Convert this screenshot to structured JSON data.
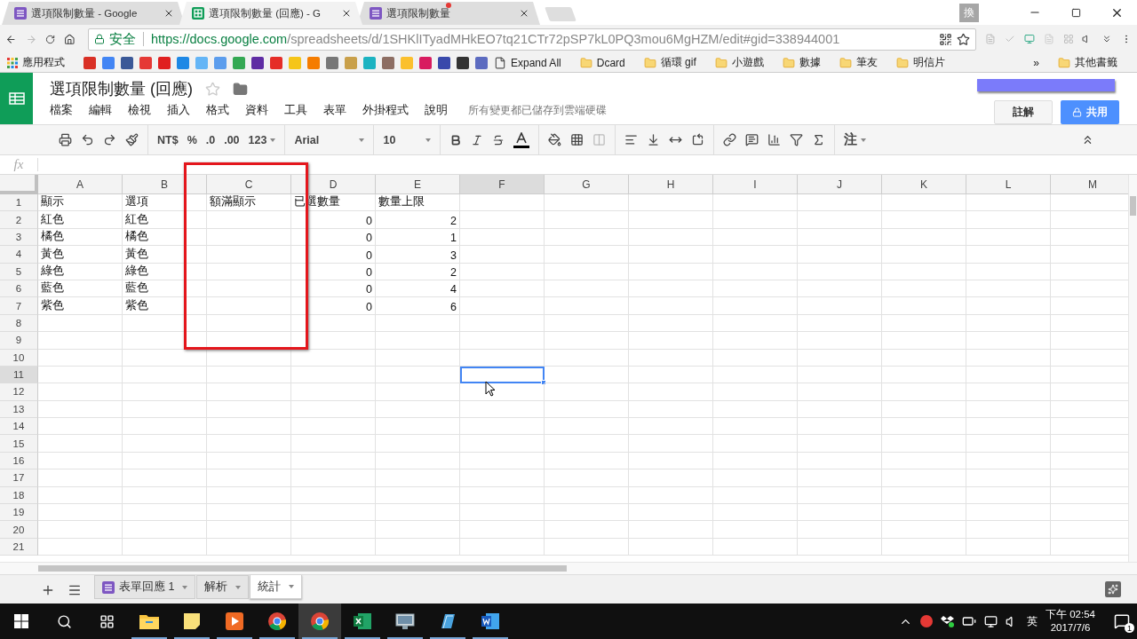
{
  "browser": {
    "tabs": [
      {
        "title": "選項限制數量 - Google",
        "kind": "form",
        "selected": false,
        "alert": false
      },
      {
        "title": "選項限制數量 (回應) - G",
        "kind": "sheet",
        "selected": true,
        "alert": false
      },
      {
        "title": "選項限制數量",
        "kind": "form",
        "selected": false,
        "alert": true
      }
    ],
    "ime_indicator": "換",
    "address": {
      "security": "安全",
      "origin": "https://docs.google.com",
      "path": "/spreadsheets/d/1SHKlITyadMHkEO7tq21CTr72pSP7kL0PQ3mou6MgHZM/edit#gid=338944001"
    },
    "bookmarks": {
      "apps_label": "應用程式",
      "items": [
        {
          "label": "Expand All",
          "kind": "page"
        },
        {
          "label": "Dcard",
          "kind": "folder"
        },
        {
          "label": "循環 gif",
          "kind": "folder"
        },
        {
          "label": "小遊戲",
          "kind": "folder"
        },
        {
          "label": "數據",
          "kind": "folder"
        },
        {
          "label": "筆友",
          "kind": "folder"
        },
        {
          "label": "明信片",
          "kind": "folder"
        }
      ],
      "overflow": "»",
      "other": "其他書籤"
    }
  },
  "document": {
    "title": "選項限制數量 (回應)",
    "starred": false,
    "menu": [
      "檔案",
      "編輯",
      "檢視",
      "插入",
      "格式",
      "資料",
      "工具",
      "表單",
      "外掛程式",
      "說明"
    ],
    "save_status": "所有變更都已儲存到雲端硬碟",
    "comments_button": "註解",
    "share_button": "共用"
  },
  "toolbar": {
    "currency": "NT$",
    "percent": "%",
    "decrease_decimals": ".0",
    "increase_decimals": ".00",
    "more_formats": "123",
    "font": "Arial",
    "font_size": "10",
    "note": "注"
  },
  "formula_bar": {
    "label": "fx"
  },
  "grid": {
    "columns": [
      {
        "label": "A",
        "selected": false
      },
      {
        "label": "B",
        "selected": false
      },
      {
        "label": "C",
        "selected": false
      },
      {
        "label": "D",
        "selected": false
      },
      {
        "label": "E",
        "selected": false
      },
      {
        "label": "F",
        "selected": true
      },
      {
        "label": "G",
        "selected": false
      },
      {
        "label": "H",
        "selected": false
      },
      {
        "label": "I",
        "selected": false
      },
      {
        "label": "J",
        "selected": false
      },
      {
        "label": "K",
        "selected": false
      },
      {
        "label": "L",
        "selected": false
      },
      {
        "label": "M",
        "selected": false
      }
    ],
    "rows": [
      {
        "number": "1",
        "selected": false,
        "cells": [
          {
            "kind": "text",
            "text": "顯示"
          },
          {
            "kind": "text",
            "text": "選項"
          },
          {
            "kind": "text",
            "text": "額滿顯示"
          },
          {
            "kind": "text",
            "text": "已選數量"
          },
          {
            "kind": "text",
            "text": "數量上限"
          }
        ]
      },
      {
        "number": "2",
        "selected": false,
        "cells": [
          {
            "kind": "text",
            "text": "紅色"
          },
          {
            "kind": "text",
            "text": "紅色"
          },
          {
            "kind": "blank"
          },
          {
            "kind": "number",
            "text": "0"
          },
          {
            "kind": "number",
            "text": "2"
          }
        ]
      },
      {
        "number": "3",
        "selected": false,
        "cells": [
          {
            "kind": "text",
            "text": "橘色"
          },
          {
            "kind": "text",
            "text": "橘色"
          },
          {
            "kind": "blank"
          },
          {
            "kind": "number",
            "text": "0"
          },
          {
            "kind": "number",
            "text": "1"
          }
        ]
      },
      {
        "number": "4",
        "selected": false,
        "cells": [
          {
            "kind": "text",
            "text": "黃色"
          },
          {
            "kind": "text",
            "text": "黃色"
          },
          {
            "kind": "blank"
          },
          {
            "kind": "number",
            "text": "0"
          },
          {
            "kind": "number",
            "text": "3"
          }
        ]
      },
      {
        "number": "5",
        "selected": false,
        "cells": [
          {
            "kind": "text",
            "text": "綠色"
          },
          {
            "kind": "text",
            "text": "綠色"
          },
          {
            "kind": "blank"
          },
          {
            "kind": "number",
            "text": "0"
          },
          {
            "kind": "number",
            "text": "2"
          }
        ]
      },
      {
        "number": "6",
        "selected": false,
        "cells": [
          {
            "kind": "text",
            "text": "藍色"
          },
          {
            "kind": "text",
            "text": "藍色"
          },
          {
            "kind": "blank"
          },
          {
            "kind": "number",
            "text": "0"
          },
          {
            "kind": "number",
            "text": "4"
          }
        ]
      },
      {
        "number": "7",
        "selected": false,
        "cells": [
          {
            "kind": "text",
            "text": "紫色"
          },
          {
            "kind": "text",
            "text": "紫色"
          },
          {
            "kind": "blank"
          },
          {
            "kind": "number",
            "text": "0"
          },
          {
            "kind": "number",
            "text": "6"
          }
        ]
      },
      {
        "number": "8",
        "selected": false
      },
      {
        "number": "9",
        "selected": false
      },
      {
        "number": "10",
        "selected": false
      },
      {
        "number": "11",
        "selected": true
      },
      {
        "number": "12",
        "selected": false
      },
      {
        "number": "13",
        "selected": false
      },
      {
        "number": "14",
        "selected": false
      },
      {
        "number": "15",
        "selected": false
      },
      {
        "number": "16",
        "selected": false
      },
      {
        "number": "17",
        "selected": false
      },
      {
        "number": "18",
        "selected": false
      },
      {
        "number": "19",
        "selected": false
      },
      {
        "number": "20",
        "selected": false
      },
      {
        "number": "21",
        "selected": false
      }
    ]
  },
  "sheet_tabs": [
    {
      "label": "表單回應 1",
      "kind": "form",
      "selected": false
    },
    {
      "label": "解析",
      "kind": "plain",
      "selected": false
    },
    {
      "label": "統計",
      "kind": "plain",
      "selected": true
    }
  ],
  "taskbar": {
    "apps": [
      {
        "kind": "explorer",
        "selected": false
      },
      {
        "kind": "notes",
        "selected": false
      },
      {
        "kind": "media",
        "selected": false
      },
      {
        "kind": "chrome",
        "selected": false
      },
      {
        "kind": "chrome",
        "selected": true
      },
      {
        "kind": "excel",
        "selected": false
      },
      {
        "kind": "monitor",
        "selected": false
      },
      {
        "kind": "book",
        "selected": false
      },
      {
        "kind": "word",
        "selected": false
      }
    ],
    "ime": "英",
    "time": "下午 02:54",
    "date": "2017/7/6",
    "notifications": "1"
  }
}
